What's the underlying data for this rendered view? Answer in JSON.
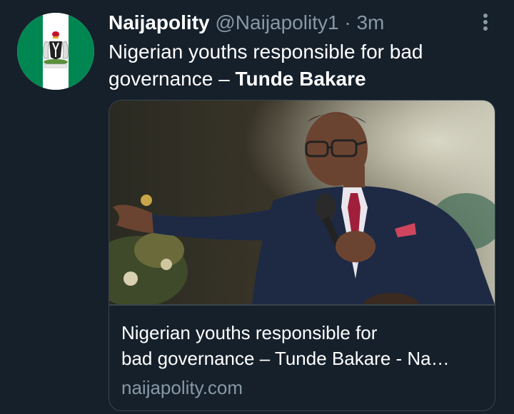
{
  "tweet": {
    "author": {
      "display_name": "Naijapolity",
      "handle": "@Naijapolity1",
      "avatar_icon": "nigeria-coat-of-arms-flag-icon"
    },
    "separator": "·",
    "time": "3m",
    "text_plain": "Nigerian youths responsible for bad governance – ",
    "text_bold": "Tunde Bakare",
    "more_icon": "more-vertical-icon",
    "card": {
      "image_description_icon": "article-photo",
      "title_line1": "Nigerian youths responsible for",
      "title_line2": "bad governance – Tunde Bakare - Na…",
      "domain": "naijapolity.com"
    }
  },
  "colors": {
    "background": "#15202b",
    "primary_text": "#ffffff",
    "secondary_text": "#8899a6",
    "border": "#38444d",
    "flag_green": "#008751"
  }
}
